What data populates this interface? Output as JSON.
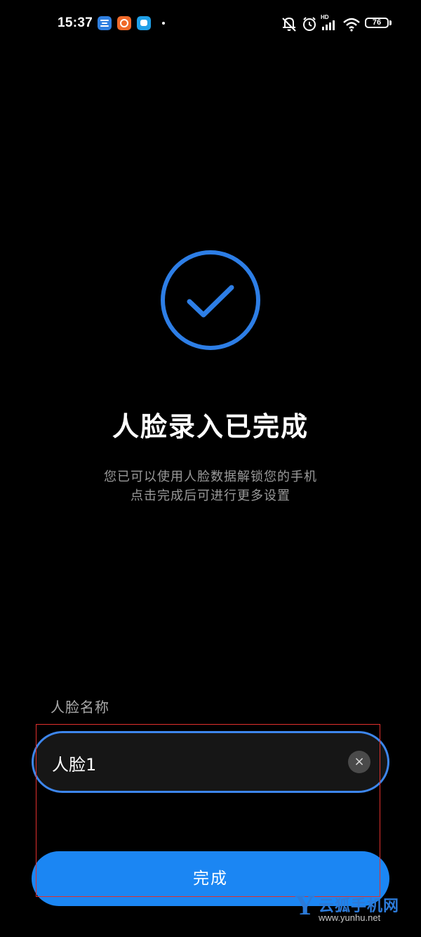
{
  "status_bar": {
    "time": "15:37",
    "network": "HD",
    "battery_level": "76",
    "icons": [
      "app-icon-blue",
      "app-icon-orange",
      "app-icon-chat",
      "mute-bell-icon",
      "alarm-icon",
      "cellular-signal-icon",
      "wifi-icon",
      "battery-icon"
    ]
  },
  "main": {
    "title": "人脸录入已完成",
    "subtitle_line1": "您已可以使用人脸数据解锁您的手机",
    "subtitle_line2": "点击完成后可进行更多设置"
  },
  "form": {
    "name_label": "人脸名称",
    "name_value": "人脸1",
    "clear_glyph": "×"
  },
  "actions": {
    "done_label": "完成"
  },
  "watermark": {
    "logo_letter": "Y",
    "brand": "云狐手机网",
    "url": "www.yunhu.net"
  },
  "colors": {
    "accent": "#1b86f3",
    "outline": "#3d86ec",
    "background": "#000000",
    "annotation_box": "#e0302d"
  }
}
